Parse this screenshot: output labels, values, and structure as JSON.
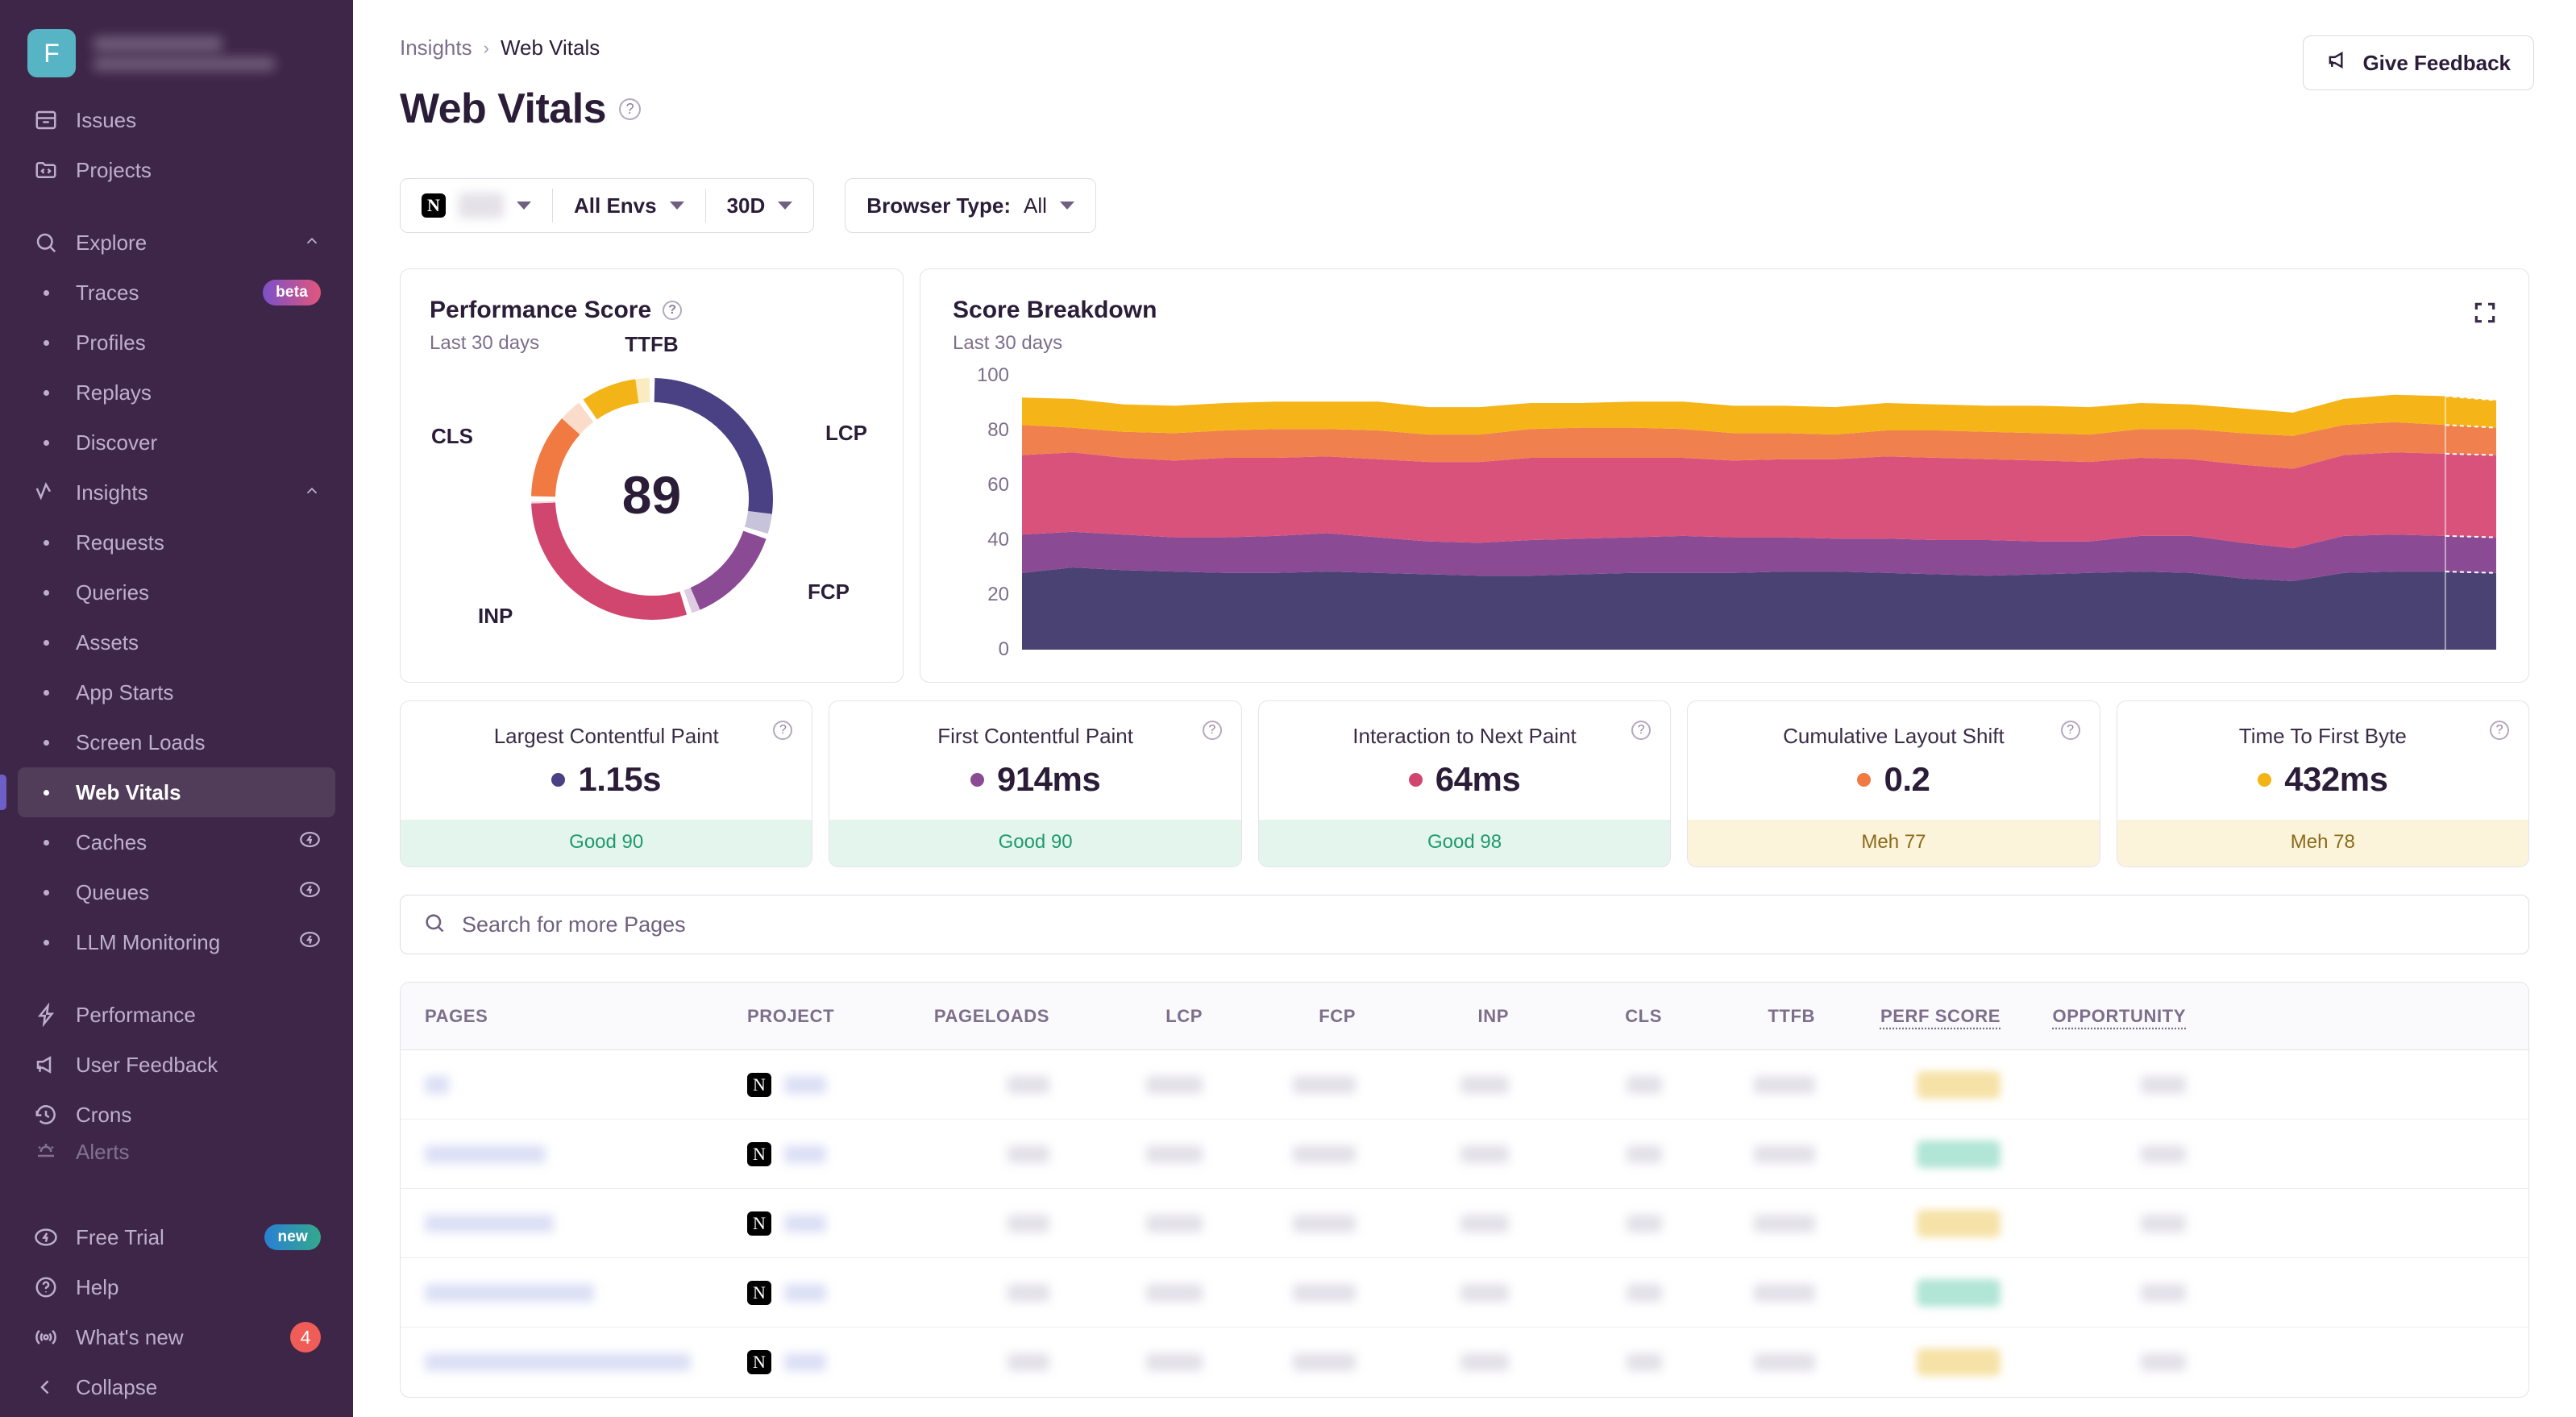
{
  "sidebar": {
    "org": {
      "initial": "F",
      "name_redacted": true
    },
    "top_items": [
      {
        "label": "Issues",
        "icon": "issues-icon"
      },
      {
        "label": "Projects",
        "icon": "projects-icon"
      }
    ],
    "groups": [
      {
        "label": "Explore",
        "icon": "search-icon",
        "expanded": true,
        "items": [
          {
            "label": "Traces",
            "tag": "beta"
          },
          {
            "label": "Profiles"
          },
          {
            "label": "Replays"
          },
          {
            "label": "Discover"
          }
        ]
      },
      {
        "label": "Insights",
        "icon": "insights-icon",
        "expanded": true,
        "items": [
          {
            "label": "Requests"
          },
          {
            "label": "Queries"
          },
          {
            "label": "Assets"
          },
          {
            "label": "App Starts"
          },
          {
            "label": "Screen Loads"
          },
          {
            "label": "Web Vitals",
            "active": true
          },
          {
            "label": "Caches",
            "bolt": true
          },
          {
            "label": "Queues",
            "bolt": true
          },
          {
            "label": "LLM Monitoring",
            "bolt": true
          }
        ]
      }
    ],
    "lower_items": [
      {
        "label": "Performance",
        "icon": "bolt-icon"
      },
      {
        "label": "User Feedback",
        "icon": "megaphone-icon"
      },
      {
        "label": "Crons",
        "icon": "clock-history-icon"
      },
      {
        "label": "Alerts",
        "icon": "siren-icon",
        "cutoff": true
      }
    ],
    "bottom_items": [
      {
        "label": "Free Trial",
        "icon": "bolt-circle-icon",
        "tag": "new"
      },
      {
        "label": "Help",
        "icon": "question-circle-icon"
      },
      {
        "label": "What's new",
        "icon": "broadcast-icon",
        "count": "4"
      }
    ],
    "collapse": {
      "label": "Collapse",
      "icon": "chevron-left-icon"
    }
  },
  "header": {
    "breadcrumb": {
      "parent": "Insights",
      "separator": "›",
      "current": "Web Vitals"
    },
    "title": "Web Vitals",
    "feedback_button": "Give Feedback"
  },
  "filters": {
    "project": {
      "logo": "N",
      "value_redacted": true
    },
    "environment": "All Envs",
    "period": "30D",
    "browser_type_label": "Browser Type:",
    "browser_type_value": "All"
  },
  "performance_score": {
    "title": "Performance Score",
    "subtitle": "Last 30 days",
    "score": "89"
  },
  "score_breakdown": {
    "title": "Score Breakdown",
    "subtitle": "Last 30 days"
  },
  "vitals": [
    {
      "name": "Largest Contentful Paint",
      "value": "1.15s",
      "dot_color": "#4A4084",
      "status": "Good 90",
      "status_type": "good"
    },
    {
      "name": "First Contentful Paint",
      "value": "914ms",
      "dot_color": "#8A4A94",
      "status": "Good 90",
      "status_type": "good"
    },
    {
      "name": "Interaction to Next Paint",
      "value": "64ms",
      "dot_color": "#D1466F",
      "status": "Good 98",
      "status_type": "good"
    },
    {
      "name": "Cumulative Layout Shift",
      "value": "0.2",
      "dot_color": "#F07A42",
      "status": "Meh 77",
      "status_type": "meh"
    },
    {
      "name": "Time To First Byte",
      "value": "432ms",
      "dot_color": "#F2B417",
      "status": "Meh 78",
      "status_type": "meh"
    }
  ],
  "search": {
    "placeholder": "Search for more Pages"
  },
  "table": {
    "columns": [
      {
        "key": "pages",
        "label": "PAGES"
      },
      {
        "key": "project",
        "label": "PROJECT"
      },
      {
        "key": "pageloads",
        "label": "PAGELOADS"
      },
      {
        "key": "lcp",
        "label": "LCP"
      },
      {
        "key": "fcp",
        "label": "FCP"
      },
      {
        "key": "inp",
        "label": "INP"
      },
      {
        "key": "cls",
        "label": "CLS"
      },
      {
        "key": "ttfb",
        "label": "TTFB"
      },
      {
        "key": "perf_score",
        "label": "PERF SCORE",
        "sortable": true
      },
      {
        "key": "opportunity",
        "label": "OPPORTUNITY",
        "sortable": true
      }
    ],
    "rows": [
      {
        "redacted": true,
        "project_logo": "N",
        "perf_badge": "meh"
      },
      {
        "redacted": true,
        "project_logo": "N",
        "perf_badge": "good"
      },
      {
        "redacted": true,
        "project_logo": "N",
        "perf_badge": "meh"
      },
      {
        "redacted": true,
        "project_logo": "N",
        "perf_badge": "good"
      },
      {
        "redacted": true,
        "project_logo": "N",
        "perf_badge": "meh"
      }
    ]
  },
  "chart_data": [
    {
      "type": "pie",
      "title": "Performance Score",
      "subtitle": "Last 30 days",
      "center_label": "89",
      "legend_position": "around-ring",
      "labels": [
        "LCP",
        "FCP",
        "INP",
        "CLS",
        "TTFB"
      ],
      "weights": [
        30,
        15,
        30,
        15,
        10
      ],
      "achieved": [
        27.0,
        13.5,
        29.4,
        11.6,
        7.8
      ],
      "missing": [
        3.0,
        1.5,
        0.6,
        3.4,
        2.2
      ],
      "colors": [
        "#4A4084",
        "#8A4A94",
        "#D1466F",
        "#F07A42",
        "#F2B417"
      ],
      "missing_colors": [
        "#C6C3DB",
        "#DFCBE2",
        "#F6D3DF",
        "#FBDCCB",
        "#FBEBC0"
      ]
    },
    {
      "type": "area",
      "stacked": true,
      "title": "Score Breakdown",
      "subtitle": "Last 30 days",
      "ylabel": "",
      "xlabel": "",
      "ylim": [
        0,
        100
      ],
      "yticks": [
        0,
        20,
        40,
        60,
        80,
        100
      ],
      "grid": false,
      "last_point_projected": true,
      "x": [
        1,
        2,
        3,
        4,
        5,
        6,
        7,
        8,
        9,
        10,
        11,
        12,
        13,
        14,
        15,
        16,
        17,
        18,
        19,
        20,
        21,
        22,
        23,
        24,
        25,
        26,
        27,
        28,
        29,
        30
      ],
      "series": [
        {
          "name": "LCP",
          "color": "#494273",
          "values": [
            28,
            30,
            29,
            28.5,
            28,
            28,
            28.5,
            28,
            27.5,
            27,
            27,
            27.5,
            28,
            28,
            28,
            28.5,
            28.5,
            28,
            27.5,
            27,
            27.5,
            28,
            28.5,
            28,
            26,
            25,
            28,
            28.5,
            28.5,
            28
          ]
        },
        {
          "name": "FCP",
          "color": "#8A4A94",
          "values": [
            14,
            13,
            13,
            12.5,
            13,
            13.5,
            14,
            13,
            12,
            12,
            13,
            13,
            13,
            13.5,
            13,
            12.5,
            12,
            12.5,
            12.5,
            13,
            12,
            11.5,
            13,
            13.5,
            13,
            12,
            13.5,
            13.5,
            13,
            13
          ]
        },
        {
          "name": "INP",
          "color": "#D8527C",
          "values": [
            29,
            29,
            28,
            28,
            29,
            28.5,
            28,
            28.5,
            29,
            29.5,
            30,
            29.5,
            29,
            28.5,
            28,
            28.5,
            29,
            30,
            30,
            29.5,
            29.5,
            29,
            28.5,
            28,
            28.5,
            29,
            29.5,
            30,
            30,
            30
          ]
        },
        {
          "name": "CLS",
          "color": "#F0804E",
          "values": [
            11,
            9,
            9.5,
            10,
            10,
            10.5,
            10,
            10.5,
            10,
            10,
            10.5,
            11,
            11,
            10.5,
            10,
            9.5,
            9,
            9.5,
            10,
            10,
            10,
            10,
            10.5,
            11,
            11.5,
            12,
            11,
            11,
            10.5,
            10
          ]
        },
        {
          "name": "TTFB",
          "color": "#F5B518",
          "values": [
            10,
            10.5,
            10,
            10,
            10,
            10,
            10,
            10.5,
            10,
            10,
            9.5,
            9,
            9.5,
            10,
            10,
            10,
            10,
            10,
            9.5,
            9.5,
            10,
            10,
            9.5,
            9,
            9,
            8.5,
            9.5,
            10,
            10.5,
            10
          ]
        }
      ]
    }
  ]
}
